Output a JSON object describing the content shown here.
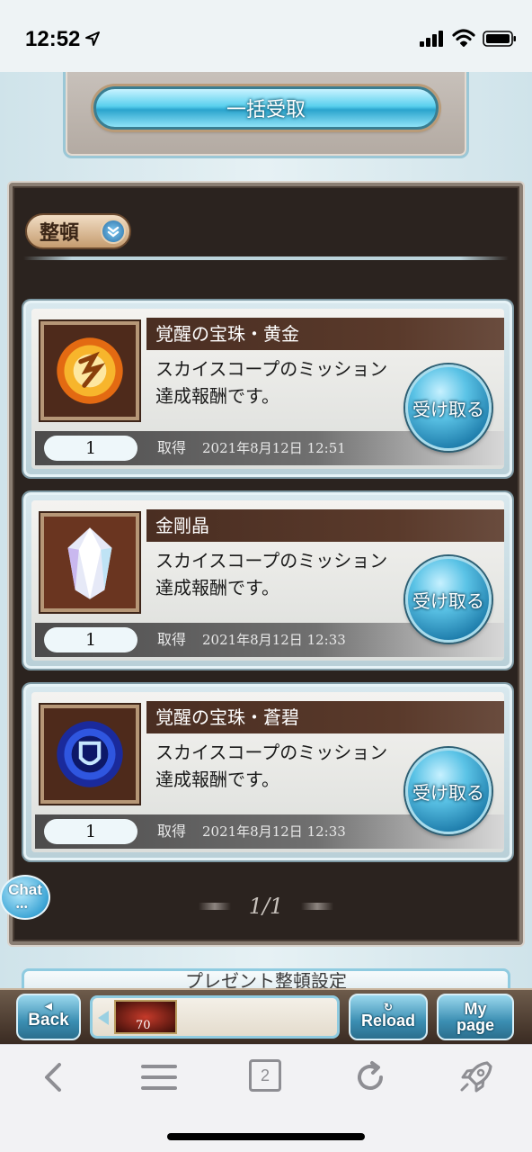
{
  "status_bar": {
    "time": "12:52"
  },
  "bulk_receive": {
    "label": "一括受取"
  },
  "sort": {
    "label": "整頓"
  },
  "items": [
    {
      "name": "覚醒の宝珠・黄金",
      "description": "スカイスコープのミッション達成報酬です。",
      "quantity": "1",
      "acquired_label": "取得",
      "acquired_date": "2021年8月12日 12:51",
      "receive_label": "受け取る",
      "icon": "gold-orb-icon",
      "accent": "#f2a51d"
    },
    {
      "name": "金剛晶",
      "description": "スカイスコープのミッション達成報酬です。",
      "quantity": "1",
      "acquired_label": "取得",
      "acquired_date": "2021年8月12日 12:33",
      "receive_label": "受け取る",
      "icon": "crystal-icon",
      "accent": "#e8eaf8"
    },
    {
      "name": "覚醒の宝珠・蒼碧",
      "description": "スカイスコープのミッション達成報酬です。",
      "quantity": "1",
      "acquired_label": "取得",
      "acquired_date": "2021年8月12日 12:33",
      "receive_label": "受け取る",
      "icon": "blue-orb-icon",
      "accent": "#2a4fd6"
    }
  ],
  "pager": {
    "text": "1/1"
  },
  "chat": {
    "label": "Chat"
  },
  "settings_strip": {
    "label": "プレゼント整頓設定"
  },
  "nav": {
    "back": [
      "Back"
    ],
    "back_label": "Back",
    "reload_label": "Reload",
    "mypage_line1": "My",
    "mypage_line2": "page",
    "level": "70"
  },
  "browser": {
    "tabs_count": "2"
  }
}
